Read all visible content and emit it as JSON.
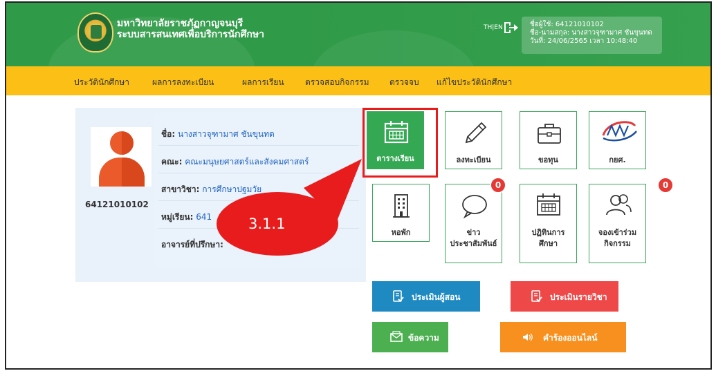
{
  "header": {
    "university_line1": "มหาวิทยาลัยราชภัฏกาญจนบุรี",
    "university_line2": "ระบบสารสนเทศเพื่อบริการนักศึกษา",
    "language": "TH|EN",
    "user_line1": "ชื่อผู้ใช้: 64121010102",
    "user_line2": "ชื่อ-นามสกุล: นางสาวจุฑามาศ ชันขุนทด",
    "user_line3": "วันที่: 24/06/2565 เวลา 10:48:40"
  },
  "nav": {
    "items": [
      "ประวัตินักศึกษา",
      "ผลการลงทะเบียน",
      "ผลการเรียน",
      "ตรวจสอบกิจกรรม",
      "ตรวจจบ",
      "แก้ไขประวัตินักศึกษา"
    ]
  },
  "profile": {
    "student_id": "64121010102",
    "name_label": "ชื่อ:",
    "name_value": "นางสาวจุฑามาศ ชันขุนทด",
    "faculty_label": "คณะ:",
    "faculty_value": "คณะมนุษยศาสตร์และสังคมศาสตร์",
    "major_label": "สาขาวิชา:",
    "major_value": "การศึกษาปฐมวัย",
    "group_label": "หมู่เรียน:",
    "group_value": "641",
    "advisor_label": "อาจารย์ที่ปรึกษา:"
  },
  "tiles": {
    "schedule": "ตารางเรียน",
    "register": "ลงทะเบียน",
    "scholarship": "ขอทุน",
    "loan": "กยศ.",
    "dorm": "หอพัก",
    "news_line1": "ข่าว",
    "news_line2": "ประชาสัมพันธ์",
    "news_badge": "0",
    "calendar_line1": "ปฏิทินการ",
    "calendar_line2": "ศึกษา",
    "activity_line1": "จองเข้าร่วม",
    "activity_line2": "กิจกรรม",
    "activity_badge": "0"
  },
  "actions": {
    "evaluate_teacher": "ประเมินผู้สอน",
    "evaluate_course": "ประเมินรายวิชา",
    "messages": "ข้อความ",
    "online_request": "คำร้องออนไลน์"
  },
  "annotation": {
    "callout_label": "3.1.1"
  },
  "colors": {
    "header_green": "#2f9a48",
    "nav_yellow": "#fbbf15",
    "tile_green": "#34a853",
    "highlight_red": "#e81c1c",
    "btn_blue": "#1f8ac2",
    "btn_red": "#ef4848",
    "btn_green": "#4caf50",
    "btn_orange": "#f7901e"
  }
}
